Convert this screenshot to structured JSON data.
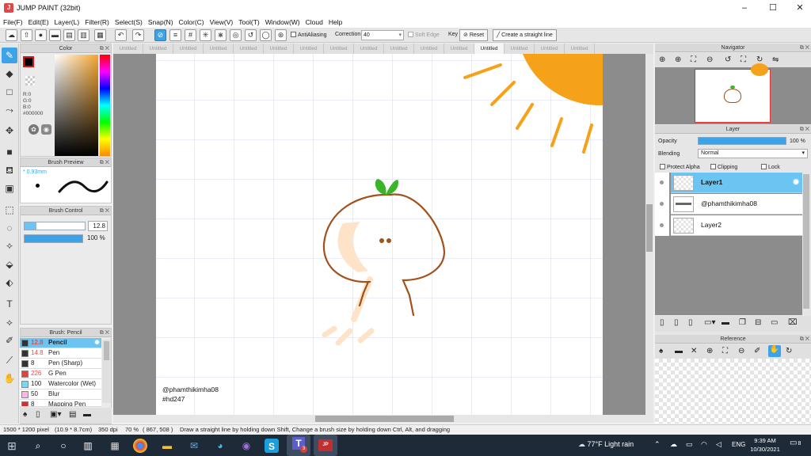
{
  "window": {
    "title": "JUMP PAINT (32bit)"
  },
  "menu": [
    "File(F)",
    "Edit(E)",
    "Layer(L)",
    "Filter(R)",
    "Select(S)",
    "Snap(N)",
    "Color(C)",
    "View(V)",
    "Tool(T)",
    "Window(W)",
    "Cloud",
    "Help"
  ],
  "toolbar": {
    "antialiasing_label": "AntiAliasing",
    "correction_label": "Correction",
    "correction_value": "40",
    "soft_edge_label": "Soft Edge",
    "key_label": "Key",
    "reset_label": "Reset",
    "straight_line_label": "Create a straight line"
  },
  "color_panel": {
    "title": "Color",
    "r": "R:0",
    "g": "G:0",
    "b": "B:0",
    "hex": "#000000",
    "foreground": "#000000"
  },
  "brush_preview": {
    "title": "Brush Preview",
    "size": "0.93mm"
  },
  "brush_control": {
    "title": "Brush Control",
    "size_value": "12.8",
    "opacity_value": "100 %",
    "opacity_fraction": 1.0,
    "size_fraction": 0.2
  },
  "brush_list": {
    "title": "Brush: Pencil",
    "items": [
      {
        "size": "12.8",
        "name": "Pencil",
        "color": "#333333"
      },
      {
        "size": "14.8",
        "name": "Pen",
        "color": "#333333"
      },
      {
        "size": "8",
        "name": "Pen (Sharp)",
        "color": "#333333"
      },
      {
        "size": "226",
        "name": "G Pen",
        "color": "#e04040"
      },
      {
        "size": "100",
        "name": "Watercolor (Wet)",
        "color": "#7fd4f0"
      },
      {
        "size": "50",
        "name": "Blur",
        "color": "#f5b8ea"
      },
      {
        "size": "8",
        "name": "Mapping Pen",
        "color": "#d03030"
      }
    ]
  },
  "tabs": [
    "Untitled",
    "Untitled",
    "Untitled",
    "Untitled",
    "Untitled",
    "Untitled",
    "Untitled",
    "Untitled",
    "Untitled",
    "Untitled",
    "Untitled",
    "Untitled",
    "Untitled",
    "Untitled",
    "Untitled",
    "Untitled"
  ],
  "active_tab_index": 12,
  "canvas": {
    "watermark_line1": "@phamthikimha08",
    "watermark_line2": "#hd247"
  },
  "navigator": {
    "title": "Navigator"
  },
  "layer_panel": {
    "title": "Layer",
    "opacity_label": "Opacity",
    "opacity_value": "100 %",
    "blending_label": "Blending",
    "blending_value": "Normal",
    "protect_alpha": "Protect Alpha",
    "clipping": "Clipping",
    "lock": "Lock",
    "layers": [
      "Layer1",
      "@phamthikimha08",
      "Layer2"
    ]
  },
  "reference": {
    "title": "Reference"
  },
  "status": {
    "pixels": "1500 * 1200 pixel",
    "size": "(10.9 * 8.7cm)",
    "dpi": "350 dpi",
    "zoom": "70 %",
    "coords": "( 867, 508 )",
    "hint": "Draw a straight line by holding down Shift, Change a brush size by holding down Ctrl, Alt, and dragging"
  },
  "taskbar": {
    "weather": "77°F  Light rain",
    "lang": "ENG",
    "time": "9:39 AM",
    "date": "10/30/2021",
    "notifications": "8",
    "teams_badge": "3"
  },
  "colors": {
    "accent": "#3ca3e8",
    "sun": "#f6a11a",
    "drawing": "#a0521a",
    "leaf": "#3ab52a"
  }
}
